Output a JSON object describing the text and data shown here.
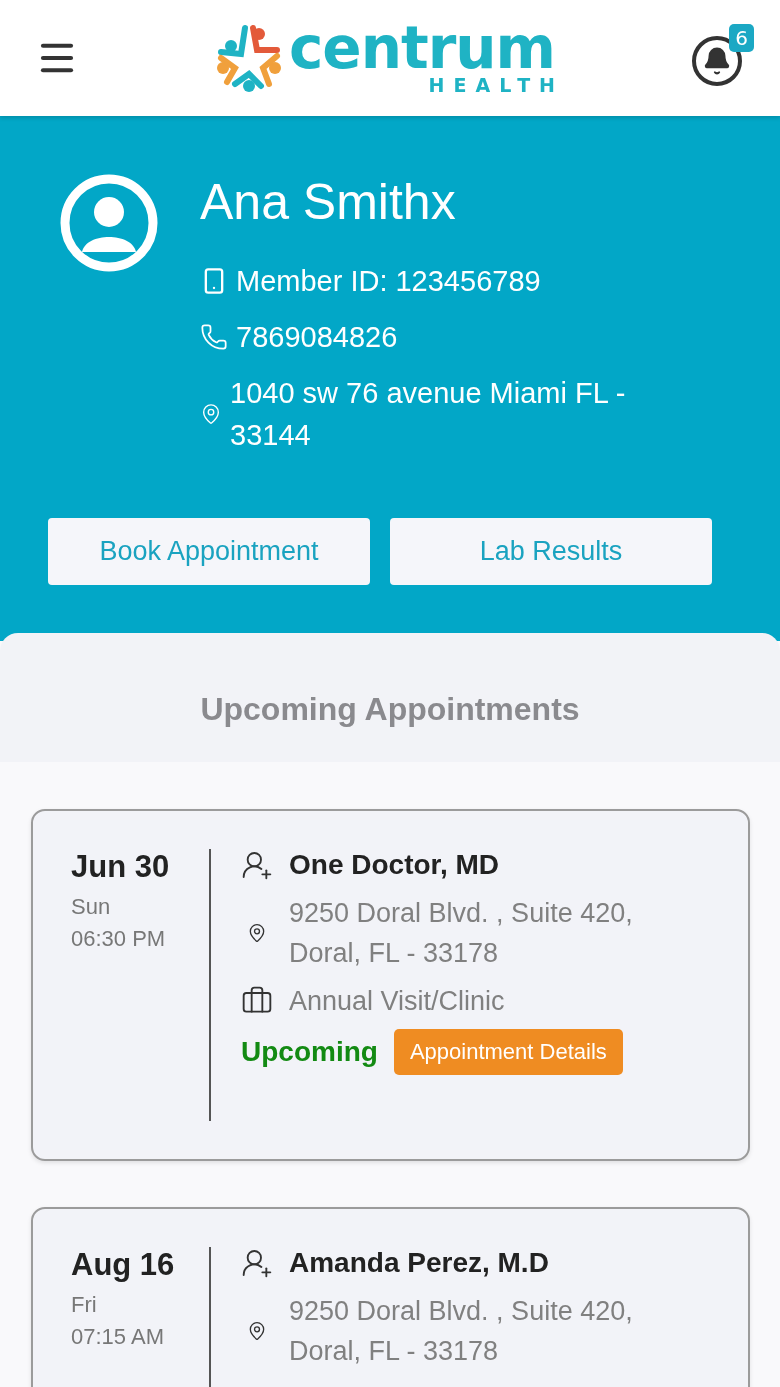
{
  "header": {
    "logo_name": "centrum",
    "logo_sub": "HEALTH",
    "notification_count": "6"
  },
  "profile": {
    "name": "Ana Smithx",
    "member_label": "Member ID:",
    "member_id": "123456789",
    "phone": "7869084826",
    "address": "1040 sw 76 avenue Miami FL - 33144"
  },
  "actions": [
    "Book Appointment",
    "Lab Results"
  ],
  "section_title": "Upcoming Appointments",
  "appointments": [
    {
      "date": "Jun 30",
      "weekday": "Sun",
      "time": "06:30 PM",
      "doctor": "One Doctor, MD",
      "address": "9250 Doral Blvd. , Suite 420, Doral, FL - 33178",
      "visit_type": "Annual Visit/Clinic",
      "status": "Upcoming",
      "details_button": "Appointment Details"
    },
    {
      "date": "Aug 16",
      "weekday": "Fri",
      "time": "07:15 AM",
      "doctor": "Amanda Perez, M.D",
      "address": "9250 Doral Blvd. , Suite 420, Doral, FL - 33178"
    }
  ]
}
